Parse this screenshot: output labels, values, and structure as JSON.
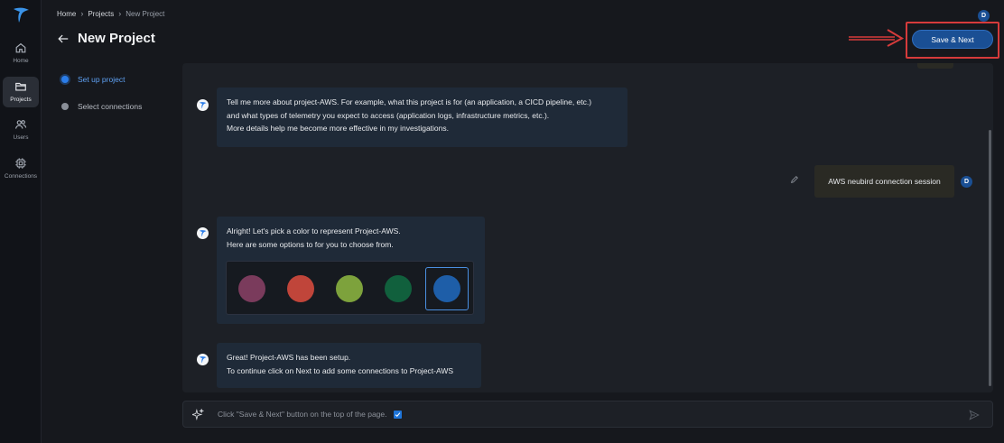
{
  "rail": {
    "items": [
      {
        "label": "Home",
        "icon": "home-icon"
      },
      {
        "label": "Projects",
        "icon": "folder-icon",
        "active": true
      },
      {
        "label": "Users",
        "icon": "users-icon"
      },
      {
        "label": "Connections",
        "icon": "chip-icon"
      }
    ]
  },
  "breadcrumb": {
    "home": "Home",
    "projects": "Projects",
    "current": "New Project"
  },
  "header": {
    "title": "New Project",
    "save_label": "Save & Next",
    "user_initial": "D"
  },
  "steps": [
    {
      "label": "Set up project",
      "active": true
    },
    {
      "label": "Select connections",
      "active": false
    }
  ],
  "chat": {
    "bot_message_1": [
      "Tell me more about project-AWS. For example, what this project is for (an application, a CICD pipeline, etc.)",
      "and what types of telemetry you expect to access (application logs, infrastructure metrics, etc.).",
      "More details help me become more effective in my investigations."
    ],
    "user_message": "AWS neubird connection session",
    "user_initial": "D",
    "bot_message_2": [
      "Alright! Let's pick a color to represent Project-AWS.",
      "Here are some options to for you to choose from."
    ],
    "color_options": [
      "#7a3b5c",
      "#c0453a",
      "#7da23c",
      "#11603d",
      "#1e5ea8"
    ],
    "selected_color_index": 4,
    "bot_message_3": [
      "Great! Project-AWS has been setup.",
      "To continue click on Next to add some connections to Project-AWS"
    ]
  },
  "composer": {
    "placeholder": "Click \"Save & Next\" button on the top of the page."
  },
  "colors": {
    "accent": "#1a4f94",
    "annotation_red": "#d63b3b"
  }
}
